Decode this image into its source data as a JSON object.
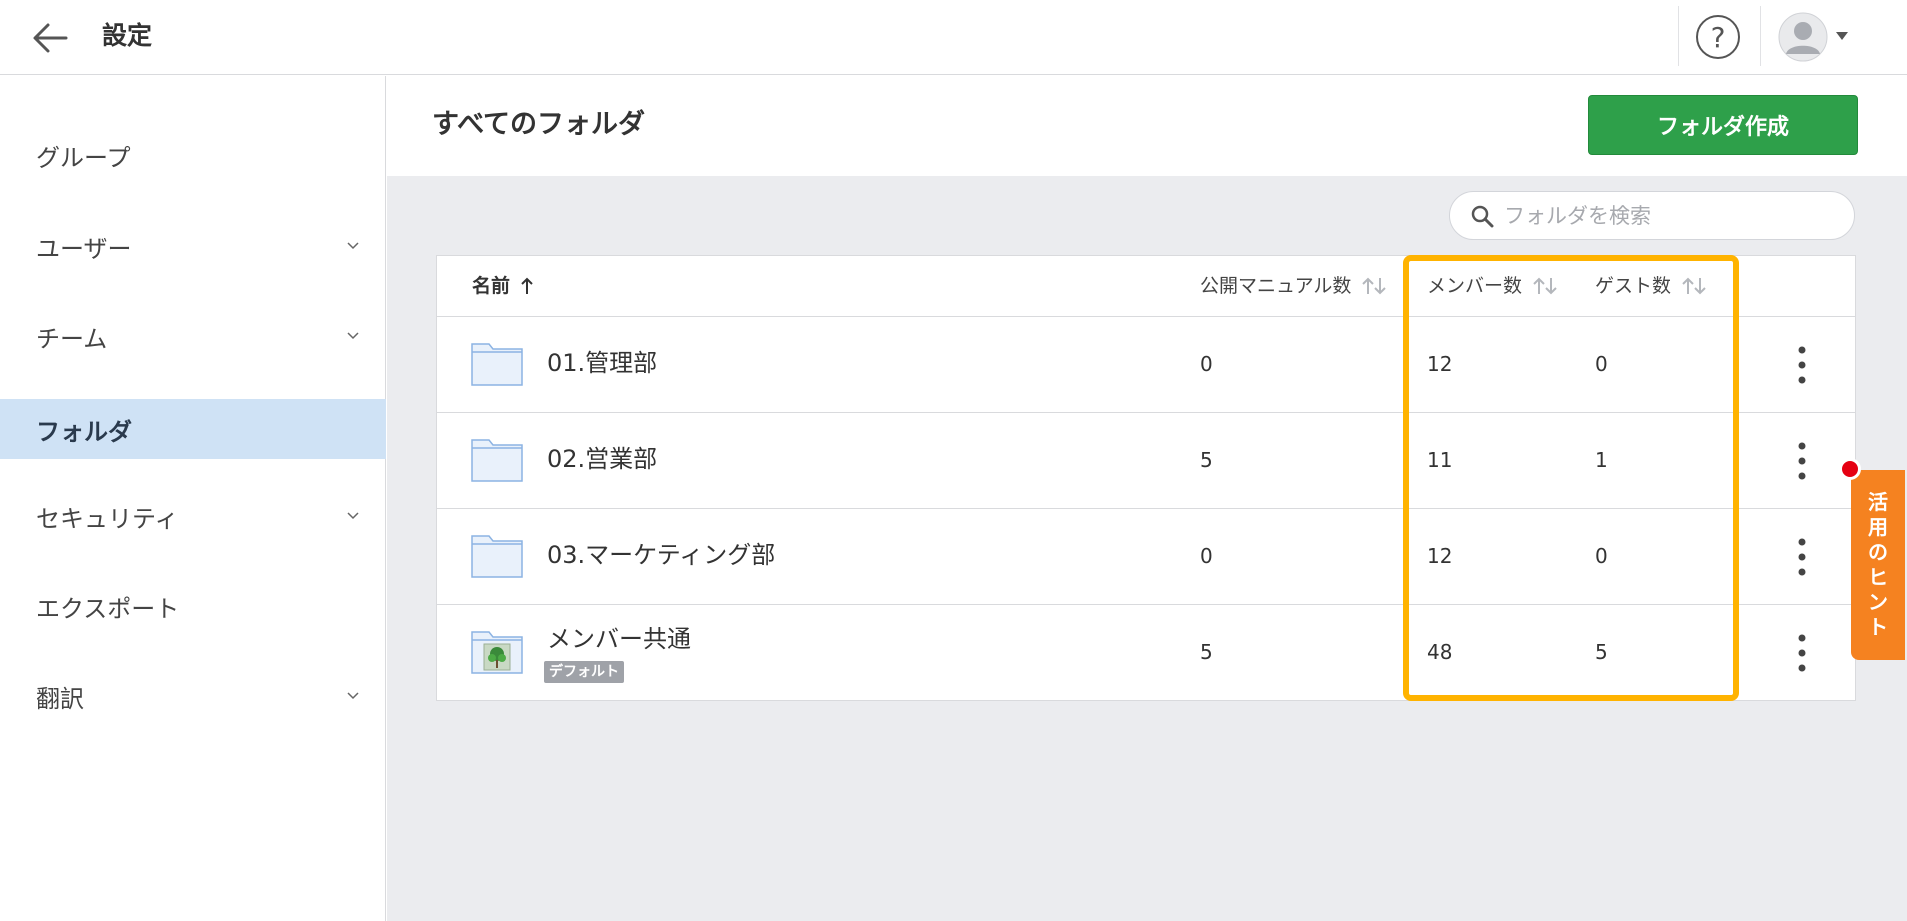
{
  "topbar": {
    "title": "設定"
  },
  "sidebar": {
    "items": [
      {
        "label": "グループ",
        "has_chevron": false
      },
      {
        "label": "ユーザー",
        "has_chevron": true
      },
      {
        "label": "チーム",
        "has_chevron": true
      },
      {
        "label": "フォルダ",
        "has_chevron": false,
        "active": true
      },
      {
        "label": "セキュリティ",
        "has_chevron": true
      },
      {
        "label": "エクスポート",
        "has_chevron": false
      },
      {
        "label": "翻訳",
        "has_chevron": true
      }
    ]
  },
  "main": {
    "title": "すべてのフォルダ",
    "create_button": "フォルダ作成",
    "search_placeholder": "フォルダを検索"
  },
  "table": {
    "columns": {
      "name": "名前",
      "manuals": "公開マニュアル数",
      "members": "メンバー数",
      "guests": "ゲスト数"
    },
    "rows": [
      {
        "name": "01.管理部",
        "manuals": "0",
        "members": "12",
        "guests": "0"
      },
      {
        "name": "02.営業部",
        "manuals": "5",
        "members": "11",
        "guests": "1"
      },
      {
        "name": "03.マーケティング部",
        "manuals": "0",
        "members": "12",
        "guests": "0"
      },
      {
        "name": "メンバー共通",
        "badge": "デフォルト",
        "manuals": "5",
        "members": "48",
        "guests": "5"
      }
    ]
  },
  "hint_tab": {
    "chars": [
      "活",
      "用",
      "の",
      "ヒ",
      "ン",
      "ト"
    ]
  },
  "colors": {
    "accent_green": "#2ea04a",
    "active_nav": "#cfe2f5",
    "highlight": "#ffb300",
    "hint_orange": "#f58220",
    "notification_red": "#e50012"
  },
  "icons": [
    "back-arrow-icon",
    "help-icon",
    "avatar-icon",
    "chevron-down-icon",
    "search-icon",
    "folder-icon",
    "sort-icon",
    "kebab-menu-icon"
  ]
}
